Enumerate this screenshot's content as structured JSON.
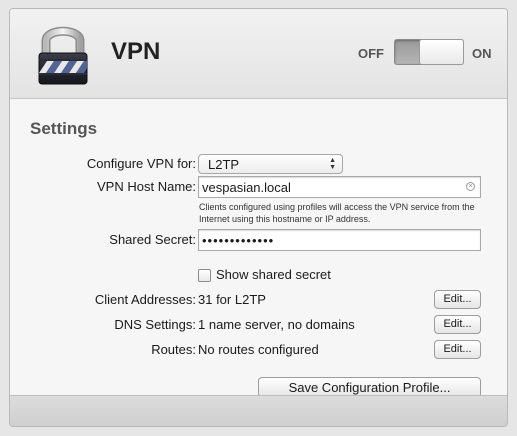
{
  "header": {
    "title": "VPN",
    "toggle": {
      "off_label": "OFF",
      "on_label": "ON",
      "state": "on"
    },
    "icon": "padlock-icon"
  },
  "settings": {
    "section_title": "Settings",
    "configure": {
      "label": "Configure VPN for:",
      "value": "L2TP"
    },
    "host": {
      "label": "VPN Host Name:",
      "value": "vespasian.local",
      "help": "Clients configured using profiles will access the VPN service from the Internet using this hostname or IP address."
    },
    "secret": {
      "label": "Shared Secret:",
      "value": "•••••••••••••"
    },
    "show_secret": {
      "label": "Show shared secret",
      "checked": false
    },
    "client_addresses": {
      "label": "Client Addresses:",
      "value": "31 for L2TP",
      "button": "Edit..."
    },
    "dns": {
      "label": "DNS Settings:",
      "value": "1 name server, no domains",
      "button": "Edit..."
    },
    "routes": {
      "label": "Routes:",
      "value": "No routes configured",
      "button": "Edit..."
    },
    "save_button": "Save Configuration Profile..."
  }
}
